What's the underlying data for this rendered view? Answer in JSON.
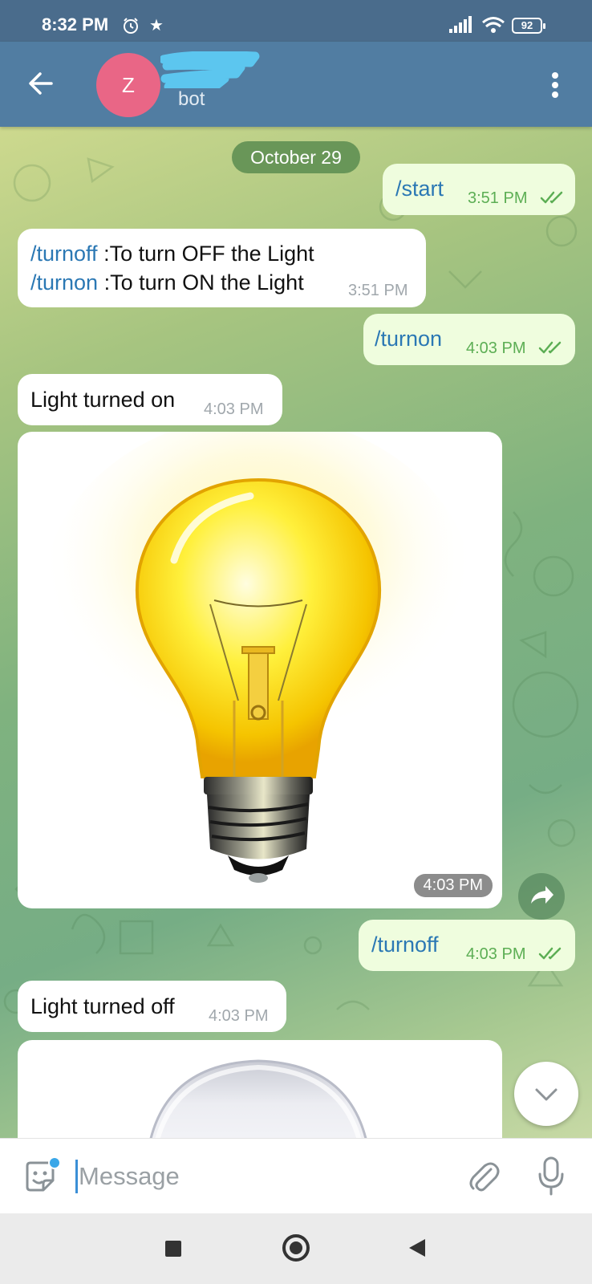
{
  "status_bar": {
    "time": "8:32 PM",
    "battery": "92"
  },
  "header": {
    "avatar_letter": "Z",
    "subtitle": "bot"
  },
  "chat": {
    "date": "October 29",
    "messages": [
      {
        "dir": "out",
        "text": "/start",
        "time": "3:51 PM"
      },
      {
        "dir": "in",
        "line1_cmd": "/turnoff",
        "line1_text": " :To turn OFF the Light",
        "line2_cmd": "/turnon",
        "line2_text": " :To turn ON the Light",
        "time": "3:51 PM"
      },
      {
        "dir": "out",
        "text": "/turnon",
        "time": "4:03 PM"
      },
      {
        "dir": "in",
        "text": "Light turned on",
        "time": "4:03 PM"
      },
      {
        "dir": "in",
        "type": "photo",
        "time": "4:03 PM"
      },
      {
        "dir": "out",
        "text": "/turnoff",
        "time": "4:03 PM"
      },
      {
        "dir": "in",
        "text": "Light turned off",
        "time": "4:03 PM"
      }
    ]
  },
  "input": {
    "placeholder": "Message"
  },
  "icons": {
    "back": "arrow-back-icon",
    "menu": "more-vertical-icon",
    "emoji": "sticker-icon",
    "attach": "paperclip-icon",
    "mic": "microphone-icon",
    "share": "share-icon",
    "scroll_down": "chevron-down-icon"
  },
  "colors": {
    "header": "#517da2",
    "status_bar": "#4a6c8c",
    "avatar": "#e96686",
    "outgoing_bubble": "#effdde",
    "command_link": "#2b78b4",
    "read_ticks": "#5cae54"
  }
}
